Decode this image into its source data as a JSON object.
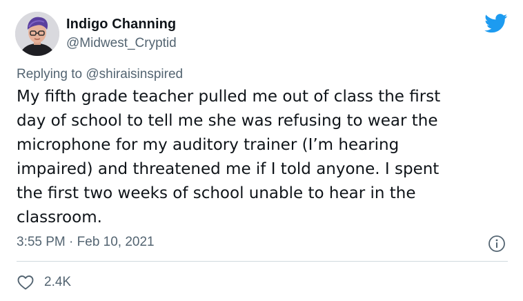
{
  "tweet": {
    "author": {
      "name": "Indigo Channing",
      "handle": "@Midwest_Cryptid"
    },
    "replying_prefix": "Replying to ",
    "replying_to": "@shiraisinspired",
    "text_lines": [
      "My fifth grade teacher pulled me out of class the first",
      "day of school to tell me she was refusing to wear the",
      "microphone for my auditory trainer (I’m hearing",
      "impaired) and threatened me if I told anyone. I spent",
      "the first two weeks of school unable to hear in the",
      "classroom."
    ],
    "timestamp": "3:55 PM · Feb 10, 2021",
    "like_count": "2.4K"
  },
  "icons": {
    "brand": "twitter-bird-icon",
    "info": "info-icon",
    "like": "heart-icon"
  },
  "colors": {
    "brand": "#1d9bf0",
    "text": "#0f1419",
    "secondary": "#536471",
    "divider": "#cfd9de"
  }
}
